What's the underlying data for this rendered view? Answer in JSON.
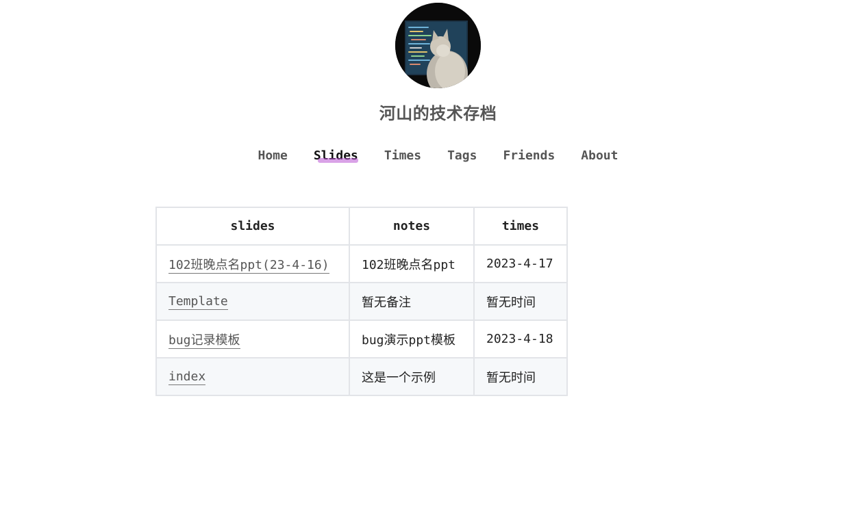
{
  "site": {
    "title": "河山的技术存档"
  },
  "nav": {
    "items": [
      {
        "label": "Home"
      },
      {
        "label": "Slides"
      },
      {
        "label": "Times"
      },
      {
        "label": "Tags"
      },
      {
        "label": "Friends"
      },
      {
        "label": "About"
      }
    ],
    "active": "Slides"
  },
  "table": {
    "headers": [
      "slides",
      "notes",
      "times"
    ],
    "rows": [
      {
        "slide": "102班晚点名ppt(23-4-16)",
        "note": "102班晚点名ppt",
        "time": "2023-4-17"
      },
      {
        "slide": "Template",
        "note": "暂无备注",
        "time": "暂无时间"
      },
      {
        "slide": "bug记录模板",
        "note": "bug演示ppt模板",
        "time": "2023-4-18"
      },
      {
        "slide": "index",
        "note": "这是一个示例",
        "time": "暂无时间"
      }
    ]
  },
  "colors": {
    "nav_text": "#555555",
    "nav_active": "#111111",
    "highlight": "#ba55d3",
    "table_border": "#e2e4e8",
    "row_alt": "#f6f8fa"
  }
}
